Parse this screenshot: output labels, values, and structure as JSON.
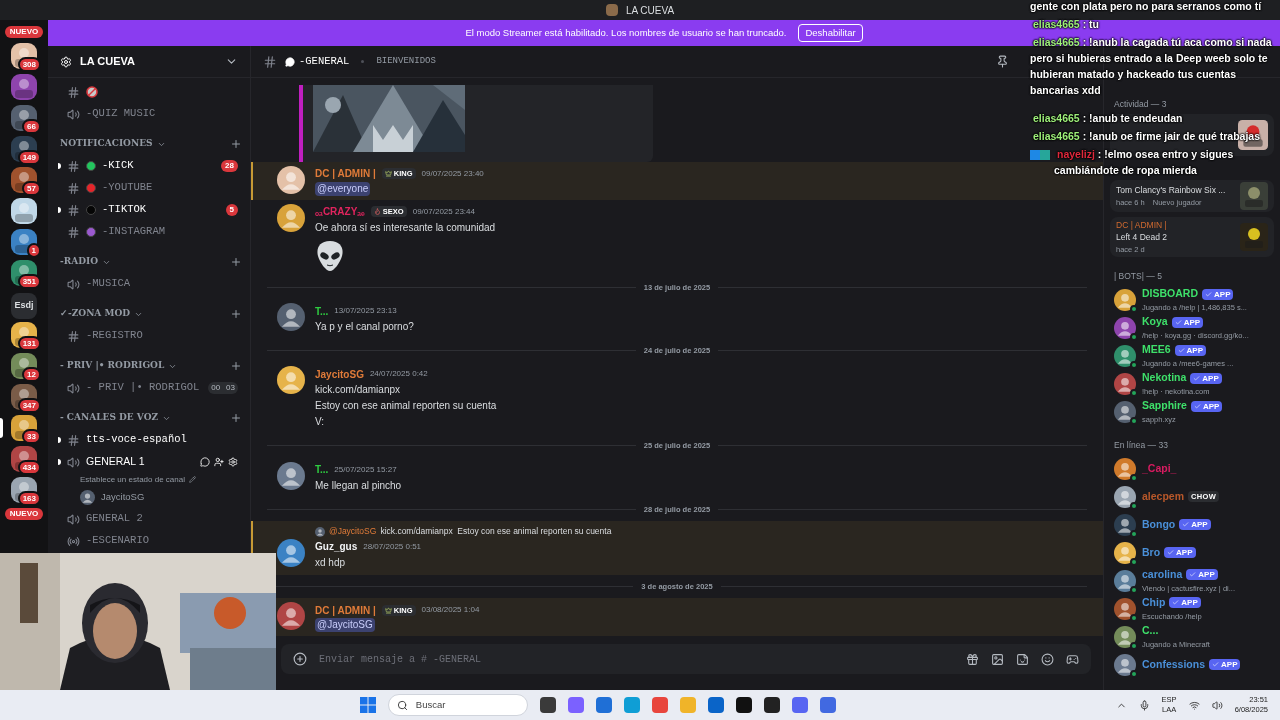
{
  "window": {
    "title": "LA CUEVA"
  },
  "banner": {
    "text": "El modo Streamer está habilitado. Los nombres de usuario se han truncado.",
    "button": "Deshabilitar"
  },
  "servers": [
    {
      "kind": "new",
      "label": "NUEVO"
    },
    {
      "kind": "icon",
      "badge": "308",
      "selected": false
    },
    {
      "kind": "icon",
      "selected": false
    },
    {
      "kind": "icon",
      "badge": "66",
      "selected": false
    },
    {
      "kind": "icon",
      "badge": "149",
      "selected": false
    },
    {
      "kind": "icon",
      "badge": "57",
      "selected": false
    },
    {
      "kind": "icon",
      "selected": false
    },
    {
      "kind": "icon",
      "badge": "1",
      "selected": false
    },
    {
      "kind": "icon",
      "badge": "351",
      "selected": false
    },
    {
      "kind": "text",
      "label": "Esdj",
      "selected": false
    },
    {
      "kind": "icon",
      "badge": "131",
      "selected": false
    },
    {
      "kind": "icon",
      "badge": "12",
      "selected": false
    },
    {
      "kind": "icon",
      "badge": "347",
      "selected": false
    },
    {
      "kind": "icon",
      "badge": "33",
      "selected": true
    },
    {
      "kind": "icon",
      "badge": "434",
      "selected": false
    },
    {
      "kind": "icon",
      "badge": "163",
      "selected": false
    },
    {
      "kind": "new",
      "label": "NUEVO"
    }
  ],
  "sidebar": {
    "server_name": "LA CUEVA",
    "channels": [
      {
        "kind": "text",
        "unread": false
      },
      {
        "kind": "voice",
        "name": "-QUIZ MUSIC",
        "unread": false
      },
      {
        "kind": "category",
        "name": "NOTIFICACIONES"
      },
      {
        "kind": "text",
        "name": "-KICK",
        "color": "#23c55e",
        "unread": true,
        "badge": "28"
      },
      {
        "kind": "text",
        "name": "-YOUTUBE",
        "color": "#e5252a",
        "unread": false
      },
      {
        "kind": "text",
        "name": "-TIKTOK",
        "color": "#050505",
        "unread": true,
        "badge": "5"
      },
      {
        "kind": "text",
        "name": "-INSTAGRAM",
        "color": "#9b59d0",
        "unread": false
      },
      {
        "kind": "category",
        "name": "-RADIO"
      },
      {
        "kind": "voice",
        "name": "-MUSICA",
        "unread": false
      },
      {
        "kind": "category",
        "name": "✓-ZONA MOD"
      },
      {
        "kind": "text",
        "name": "-REGISTRO",
        "unread": false
      },
      {
        "kind": "category",
        "name": "- PRIV |• RODRIGOL"
      },
      {
        "kind": "voice",
        "name": "- PRIV |• RODRIGOL",
        "unread": false,
        "counters": [
          "00",
          "03"
        ]
      },
      {
        "kind": "category",
        "name": "- CANALES DE VOZ"
      },
      {
        "kind": "text",
        "name": "tts-voce-español",
        "unread": true
      },
      {
        "kind": "voice",
        "name": "GENERAL 1",
        "unread": true,
        "status": "Establece un estado de canal",
        "users": [
          "JaycitoSG"
        ]
      },
      {
        "kind": "voice",
        "name": "GENERAL 2",
        "unread": false
      },
      {
        "kind": "stage",
        "name": "-ESCENARIO",
        "unread": false
      }
    ]
  },
  "chat": {
    "channel": "-GENERAL",
    "topic": "BIENVENIDOS",
    "placeholder": "Enviar mensaje a # -GENERAL",
    "items": [
      {
        "kind": "embed"
      },
      {
        "kind": "message",
        "author": "DC | ADMIN |",
        "color": "#e07b39",
        "tag": "KING",
        "time": "09/07/2025 23:40",
        "highlighted": true,
        "lines": [
          {
            "kind": "mention",
            "text": "@everyone"
          }
        ]
      },
      {
        "kind": "message",
        "author": "ₒₐCRAZYₐₑ",
        "color": "#e0245e",
        "tag": "SEXO",
        "time": "09/07/2025 23:44",
        "highlighted": false,
        "lines": [
          {
            "kind": "text",
            "text": "Oe ahora sí es interesante la comunidad"
          },
          {
            "kind": "alien"
          }
        ]
      },
      {
        "kind": "divider",
        "text": "13 de julio de 2025"
      },
      {
        "kind": "message",
        "author": "T...",
        "color": "#2ecc40",
        "time": "13/07/2025 23:13",
        "highlighted": false,
        "lines": [
          {
            "kind": "text",
            "text": "Ya p y el canal porno?"
          }
        ]
      },
      {
        "kind": "divider",
        "text": "24 de julio de 2025"
      },
      {
        "kind": "message",
        "author": "JaycitoSG",
        "color": "#e07b39",
        "time": "24/07/2025 0:42",
        "highlighted": false,
        "lines": [
          {
            "kind": "text",
            "text": "kick.com/damianpx"
          },
          {
            "kind": "text",
            "text": "Estoy con ese animal reporten su cuenta"
          },
          {
            "kind": "text",
            "text": "V:"
          }
        ]
      },
      {
        "kind": "divider",
        "text": "25 de julio de 2025"
      },
      {
        "kind": "message",
        "author": "T...",
        "color": "#2ecc40",
        "time": "25/07/2025 15:27",
        "highlighted": false,
        "lines": [
          {
            "kind": "text",
            "text": "Me llegan al pincho"
          }
        ]
      },
      {
        "kind": "divider",
        "text": "28 de julio de 2025"
      },
      {
        "kind": "message",
        "author": "Guz_gus",
        "color": "#f2f3f5",
        "time": "28/07/2025 0:51",
        "highlighted": true,
        "reply": {
          "user": "@JaycitoSG",
          "text": "kick.com/damianpx  Estoy con ese animal reporten su cuenta"
        },
        "lines": [
          {
            "kind": "text",
            "text": "xd hdp"
          }
        ]
      },
      {
        "kind": "divider",
        "text": "3 de agosto de 2025"
      },
      {
        "kind": "message",
        "author": "DC | ADMIN |",
        "color": "#e07b39",
        "tag": "KING",
        "time": "03/08/2025 1:04",
        "highlighted": true,
        "lines": [
          {
            "kind": "mention",
            "text": "@JaycitoSG"
          }
        ]
      }
    ]
  },
  "members": {
    "activity_title": "Actividad — 3",
    "activities": [
      {
        "title": "Tom Clancy's Rainbow Six ...",
        "meta": "hace 6 h",
        "extra": "Nuevo jugador"
      },
      {
        "user": "DC | ADMIN |",
        "title": "Left 4 Dead 2",
        "meta": "hace 2 d"
      }
    ],
    "groups": [
      {
        "title": "| BOTS| — 5",
        "members": [
          {
            "name": "DISBOARD",
            "color": "#3ee06a",
            "tag": "APP",
            "status": "Jugando a /help | 1,486,835 s..."
          },
          {
            "name": "Koya",
            "color": "#3ee06a",
            "tag": "APP",
            "status": "/help · koya.gg · discord.gg/ko..."
          },
          {
            "name": "MEE6",
            "color": "#3ee06a",
            "tag": "APP",
            "status": "Jugando a  /mee6-games ..."
          },
          {
            "name": "Nekotina",
            "color": "#3ee06a",
            "tag": "APP",
            "status": "!help · nekotina.com"
          },
          {
            "name": "Sapphire",
            "color": "#3ee06a",
            "tag": "APP",
            "status": "sapph.xyz"
          }
        ]
      },
      {
        "title": "En línea — 33",
        "members": [
          {
            "name": "_Capi_",
            "color": "#d81b60"
          },
          {
            "name": "alecpem",
            "color": "#b9582a",
            "tag": "CHOW"
          },
          {
            "name": "Bongo",
            "color": "#4a90d9",
            "tag": "APP"
          },
          {
            "name": "Bro",
            "color": "#4a90d9",
            "tag": "APP"
          },
          {
            "name": "carolina",
            "color": "#4a90d9",
            "tag": "APP",
            "status": "Viendo  | cactusfire.xyz | di..."
          },
          {
            "name": "Chip",
            "color": "#4a90d9",
            "tag": "APP",
            "status": "Escuchando /help"
          },
          {
            "name": "C...",
            "color": "#3ee06a",
            "status": "Jugando a Minecraft"
          },
          {
            "name": "Confessions",
            "color": "#4a90d9",
            "tag": "APP"
          }
        ]
      }
    ]
  },
  "stream_chat": [
    {
      "text": "gente con plata pero no para serranos como tí"
    },
    {
      "user": "elias4665",
      "color": "#9ef07a",
      "sep": ":",
      "text": "tu"
    },
    {
      "user": "elias4665",
      "color": "#9ef07a",
      "sep": ":",
      "text": "!anub la cagada tú aca como si nada pero si hubieras entrado a la Deep weeb solo te hubieran matado y hackeado tus cuentas bancarias xdd"
    },
    {
      "user": "elias4665",
      "color": "#9ef07a",
      "sep": ":",
      "text": "!anub te endeudan"
    },
    {
      "user": "elias4665",
      "color": "#9ef07a",
      "sep": ":",
      "text": "!anub oe firme jair de qué trabajas"
    },
    {
      "user": "nayelizj",
      "color": "#e0283c",
      "badges": true,
      "sep": ":",
      "text": "!elmo osea entro y sigues cambiándote de ropa mierda"
    }
  ],
  "taskbar": {
    "search_placeholder": "Buscar",
    "language": "ESP",
    "layout": "LAA",
    "time": "23:51",
    "date": "6/08/2025"
  }
}
